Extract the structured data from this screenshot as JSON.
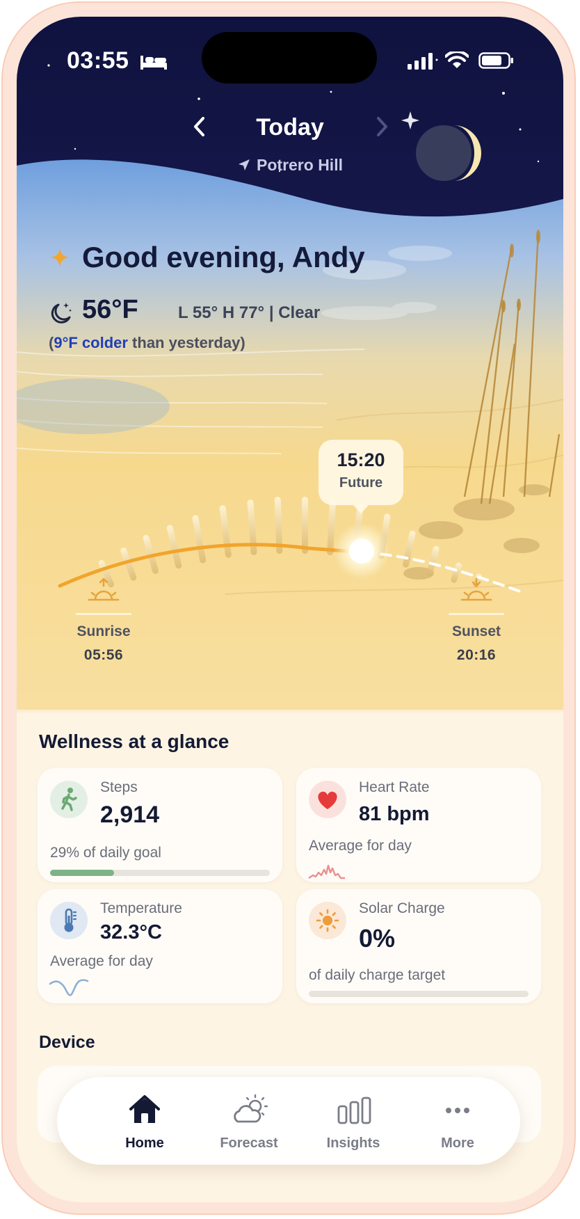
{
  "status_bar": {
    "time": "03:55"
  },
  "header": {
    "title": "Today",
    "location": "Potrero Hill"
  },
  "greeting": "Good evening, Andy",
  "weather": {
    "temperature": "56°F",
    "range": "L 55° H 77° | Clear",
    "comparison_open": "(",
    "comparison_highlight": "9°F colder",
    "comparison_rest": " than yesterday)"
  },
  "sun_timeline": {
    "current_time": "15:20",
    "current_label": "Future",
    "sunrise_label": "Sunrise",
    "sunrise_time": "05:56",
    "sunset_label": "Sunset",
    "sunset_time": "20:16"
  },
  "wellness": {
    "title": "Wellness at a glance",
    "steps": {
      "label": "Steps",
      "value": "2,914",
      "sub": "29% of daily goal",
      "progress": 0.29
    },
    "heart_rate": {
      "label": "Heart Rate",
      "value": "81 bpm",
      "sub": "Average for day"
    },
    "temperature": {
      "label": "Temperature",
      "value": "32.3°C",
      "sub": "Average for day"
    },
    "solar_charge": {
      "label": "Solar Charge",
      "value": "0%",
      "sub": "of daily charge target",
      "progress": 0
    }
  },
  "device": {
    "title": "Device"
  },
  "tabs": [
    {
      "label": "Home",
      "icon": "home-icon",
      "active": true
    },
    {
      "label": "Forecast",
      "icon": "partly-cloudy-icon",
      "active": false
    },
    {
      "label": "Insights",
      "icon": "bar-chart-icon",
      "active": false
    },
    {
      "label": "More",
      "icon": "more-icon",
      "active": false
    }
  ],
  "colors": {
    "night_sky": "#15184a",
    "sand": "#f6d78c",
    "accent_orange": "#eea93a",
    "steps_green": "#7db387",
    "heart_red": "#e53b3b",
    "highlight_blue": "#1f3fb8"
  }
}
